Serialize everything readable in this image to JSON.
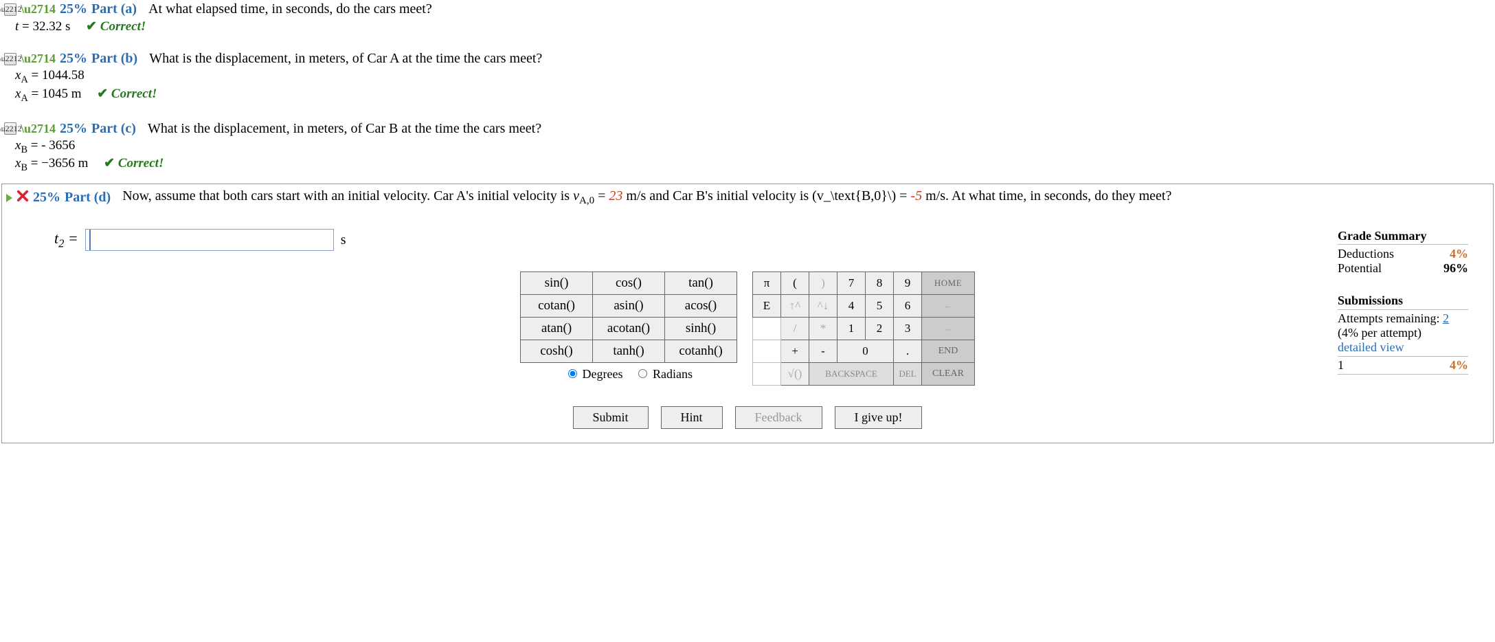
{
  "parts": {
    "a": {
      "pct": "25%",
      "label": "Part (a)",
      "question": "At what elapsed time, in seconds, do the cars meet?",
      "answer_var": "t",
      "answer_val": "= 32.32 s",
      "correct": "Correct!"
    },
    "b": {
      "pct": "25%",
      "label": "Part (b)",
      "question": "What is the displacement, in meters, of Car A at the time the cars meet?",
      "line1_var": "x",
      "line1_sub": "A",
      "line1_val": "= 1044.58",
      "line2_var": "x",
      "line2_sub": "A",
      "line2_val": "= 1045 m",
      "correct": "Correct!"
    },
    "c": {
      "pct": "25%",
      "label": "Part (c)",
      "question": "What is the displacement, in meters, of Car B at the time the cars meet?",
      "line1_var": "x",
      "line1_sub": "B",
      "line1_val": "= - 3656",
      "line2_var": "x",
      "line2_sub": "B",
      "line2_val": "= −3656 m",
      "correct": "Correct!"
    },
    "d": {
      "pct": "25%",
      "label": "Part (d)",
      "q_pre": "Now, assume that both cars start with an initial velocity. Car A's initial velocity is ",
      "vA_var": "v",
      "vA_sub": "A,0",
      "vA_eq": " = ",
      "vA_val": "23",
      "q_mid1": " m/s and Car B's initial velocity is (v_\\text{B,0}\\) = ",
      "vB_val": "-5",
      "q_mid2": " m/s. At what time, in seconds, do they meet?",
      "ans_var": "t",
      "ans_sub": "2",
      "ans_eq": " =",
      "ans_unit": "s"
    }
  },
  "grade": {
    "title": "Grade Summary",
    "ded_label": "Deductions",
    "ded_val": "4%",
    "pot_label": "Potential",
    "pot_val": "96%",
    "sub_title": "Submissions",
    "attempts_label": "Attempts remaining: ",
    "attempts_val": "2",
    "per_attempt": "(4% per attempt)",
    "detailed": "detailed view",
    "row_num": "1",
    "row_pct": "4%"
  },
  "funcs": {
    "r1c1": "sin()",
    "r1c2": "cos()",
    "r1c3": "tan()",
    "r2c1": "cotan()",
    "r2c2": "asin()",
    "r2c3": "acos()",
    "r3c1": "atan()",
    "r3c2": "acotan()",
    "r3c3": "sinh()",
    "r4c1": "cosh()",
    "r4c2": "tanh()",
    "r4c3": "cotanh()",
    "deg": "Degrees",
    "rad": "Radians"
  },
  "keys": {
    "pi": "π",
    "lp": "(",
    "rp": ")",
    "k7": "7",
    "k8": "8",
    "k9": "9",
    "home": "HOME",
    "E": "E",
    "up": "↑^",
    "dn": "^↓",
    "k4": "4",
    "k5": "5",
    "k6": "6",
    "left": "←",
    "div": "/",
    "mul": "*",
    "k1": "1",
    "k2": "2",
    "k3": "3",
    "right": "→",
    "plus": "+",
    "minus": "-",
    "k0": "0",
    "dot": ".",
    "end": "END",
    "sqrt": "√()",
    "back": "BACKSPACE",
    "del": "DEL",
    "clear": "CLEAR"
  },
  "buttons": {
    "submit": "Submit",
    "hint": "Hint",
    "feedback": "Feedback",
    "giveup": "I give up!"
  }
}
